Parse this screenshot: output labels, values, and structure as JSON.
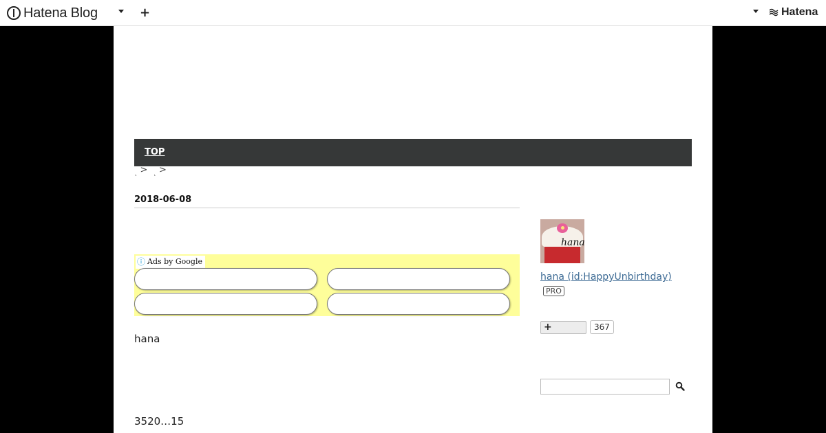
{
  "global_header": {
    "logo_text": "Hatena Blog",
    "add_label": "+",
    "brand_text": "Hatena"
  },
  "nav": {
    "top_label": "TOP"
  },
  "breadcrumb": {
    "sep": ">"
  },
  "entry": {
    "date": "2018-06-08",
    "ads_label": "Ads by Google",
    "ads_info_icon": "ⓘ",
    "author_text": "hana",
    "count_text": "3520…15"
  },
  "sidebar": {
    "avatar_text": "hana",
    "profile_link": "hana (id:HappyUnbirthday)",
    "pro_badge": "PRO",
    "follow_label": "+",
    "follow_count": "367",
    "search_placeholder": ""
  },
  "colors": {
    "nav_bg": "#363838",
    "ads_bg": "#fefe9a",
    "link": "#3c6a94",
    "page_bg": "#000000"
  },
  "icons": [
    "hatena-blog-logo-icon",
    "chevron-down-icon",
    "plus-icon",
    "hatena-logo-icon",
    "info-icon",
    "search-icon"
  ]
}
